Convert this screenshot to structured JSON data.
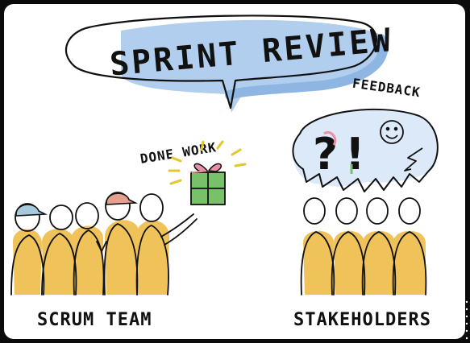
{
  "title": "SPRINT REVIEW",
  "gift_label": "DONE WORK",
  "feedback_label": "FEEDBACK",
  "team_label": "SCRUM TEAM",
  "stakeholders_label": "STAKEHOLDERS",
  "bubble_marks": {
    "question": "?",
    "exclamation": "!"
  },
  "colors": {
    "bubble_shadow": "#a9c9ec",
    "person_fill": "#f0c35a",
    "gift_box": "#79c06a",
    "gift_bow": "#e98fa8",
    "cap_blue": "#a8c8dc",
    "cap_red": "#e7a08d",
    "ray_yellow": "#e2c72b"
  },
  "icons": [
    "speech-bubble-icon",
    "gift-icon",
    "smiley-icon",
    "lightning-icon",
    "thought-cloud-icon"
  ]
}
